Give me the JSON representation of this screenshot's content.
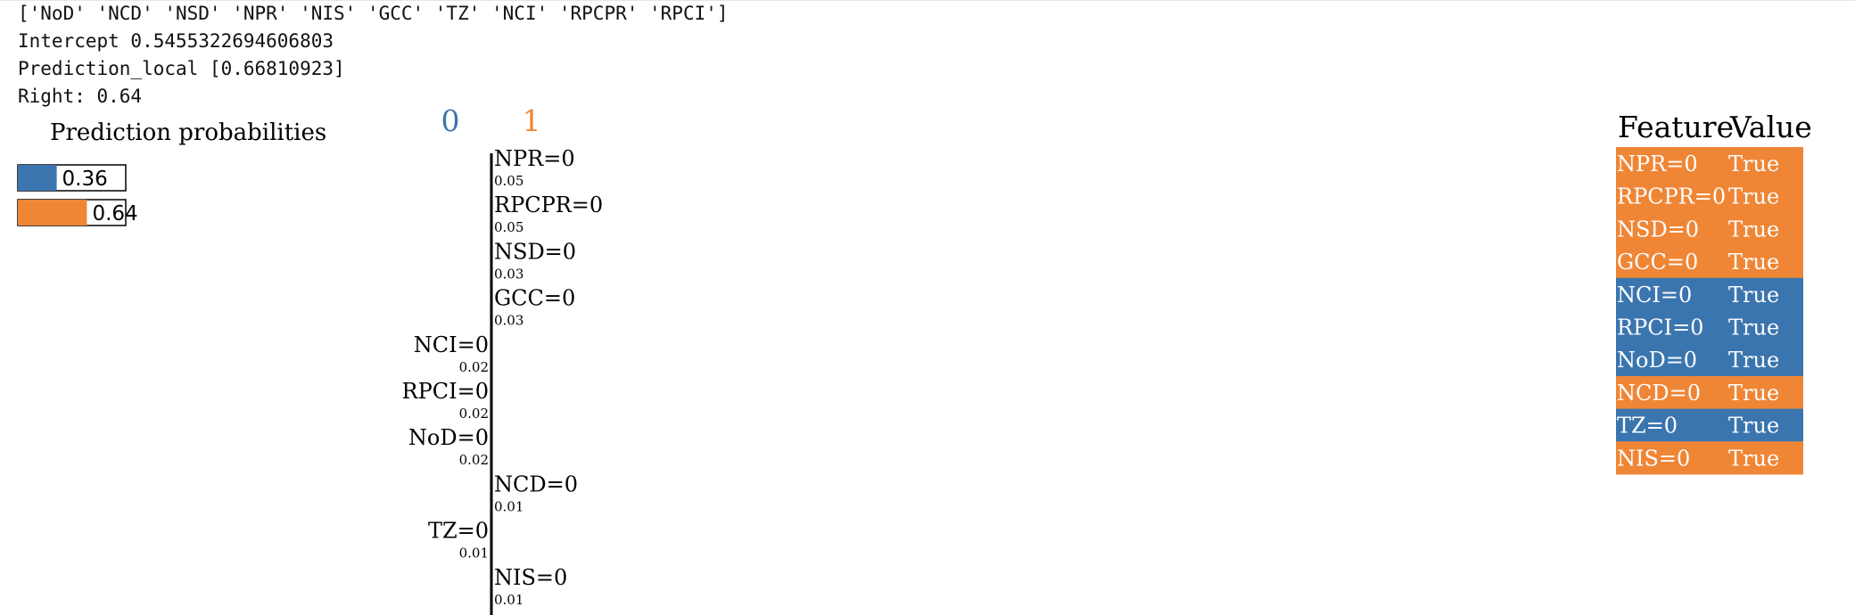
{
  "console": {
    "lines": [
      "['NoD' 'NCD' 'NSD' 'NPR' 'NIS' 'GCC' 'TZ' 'NCI' 'RPCPR' 'RPCI']",
      "Intercept 0.5455322694606803",
      "Prediction_local [0.66810923]",
      "Right: 0.64"
    ]
  },
  "colors": {
    "class0": "#3b75af",
    "class1": "#ef8636"
  },
  "chart_data": [
    {
      "type": "bar",
      "title": "Prediction probabilities",
      "categories": [
        "0",
        "1"
      ],
      "values": [
        0.36,
        0.64
      ],
      "value_labels": [
        "0.36",
        "0.64"
      ],
      "xlim": [
        0,
        1
      ]
    },
    {
      "type": "bar",
      "orientation": "horizontal",
      "class_labels": [
        "0",
        "1"
      ],
      "features": [
        {
          "name": "NPR=0",
          "weight": 0.05,
          "weight_label": "0.05",
          "class": 1
        },
        {
          "name": "RPCPR=0",
          "weight": 0.05,
          "weight_label": "0.05",
          "class": 1
        },
        {
          "name": "NSD=0",
          "weight": 0.03,
          "weight_label": "0.03",
          "class": 1
        },
        {
          "name": "GCC=0",
          "weight": 0.03,
          "weight_label": "0.03",
          "class": 1
        },
        {
          "name": "NCI=0",
          "weight": 0.02,
          "weight_label": "0.02",
          "class": 0
        },
        {
          "name": "RPCI=0",
          "weight": 0.02,
          "weight_label": "0.02",
          "class": 0
        },
        {
          "name": "NoD=0",
          "weight": 0.02,
          "weight_label": "0.02",
          "class": 0
        },
        {
          "name": "NCD=0",
          "weight": 0.01,
          "weight_label": "0.01",
          "class": 1
        },
        {
          "name": "TZ=0",
          "weight": 0.01,
          "weight_label": "0.01",
          "class": 0
        },
        {
          "name": "NIS=0",
          "weight": 0.01,
          "weight_label": "0.01",
          "class": 1
        }
      ]
    },
    {
      "type": "table",
      "columns": [
        "Feature",
        "Value"
      ],
      "rows": [
        {
          "feature": "NPR=0",
          "value": "True",
          "class": 1
        },
        {
          "feature": "RPCPR=0",
          "value": "True",
          "class": 1
        },
        {
          "feature": "NSD=0",
          "value": "True",
          "class": 1
        },
        {
          "feature": "GCC=0",
          "value": "True",
          "class": 1
        },
        {
          "feature": "NCI=0",
          "value": "True",
          "class": 0
        },
        {
          "feature": "RPCI=0",
          "value": "True",
          "class": 0
        },
        {
          "feature": "NoD=0",
          "value": "True",
          "class": 0
        },
        {
          "feature": "NCD=0",
          "value": "True",
          "class": 1
        },
        {
          "feature": "TZ=0",
          "value": "True",
          "class": 0
        },
        {
          "feature": "NIS=0",
          "value": "True",
          "class": 1
        }
      ]
    }
  ]
}
